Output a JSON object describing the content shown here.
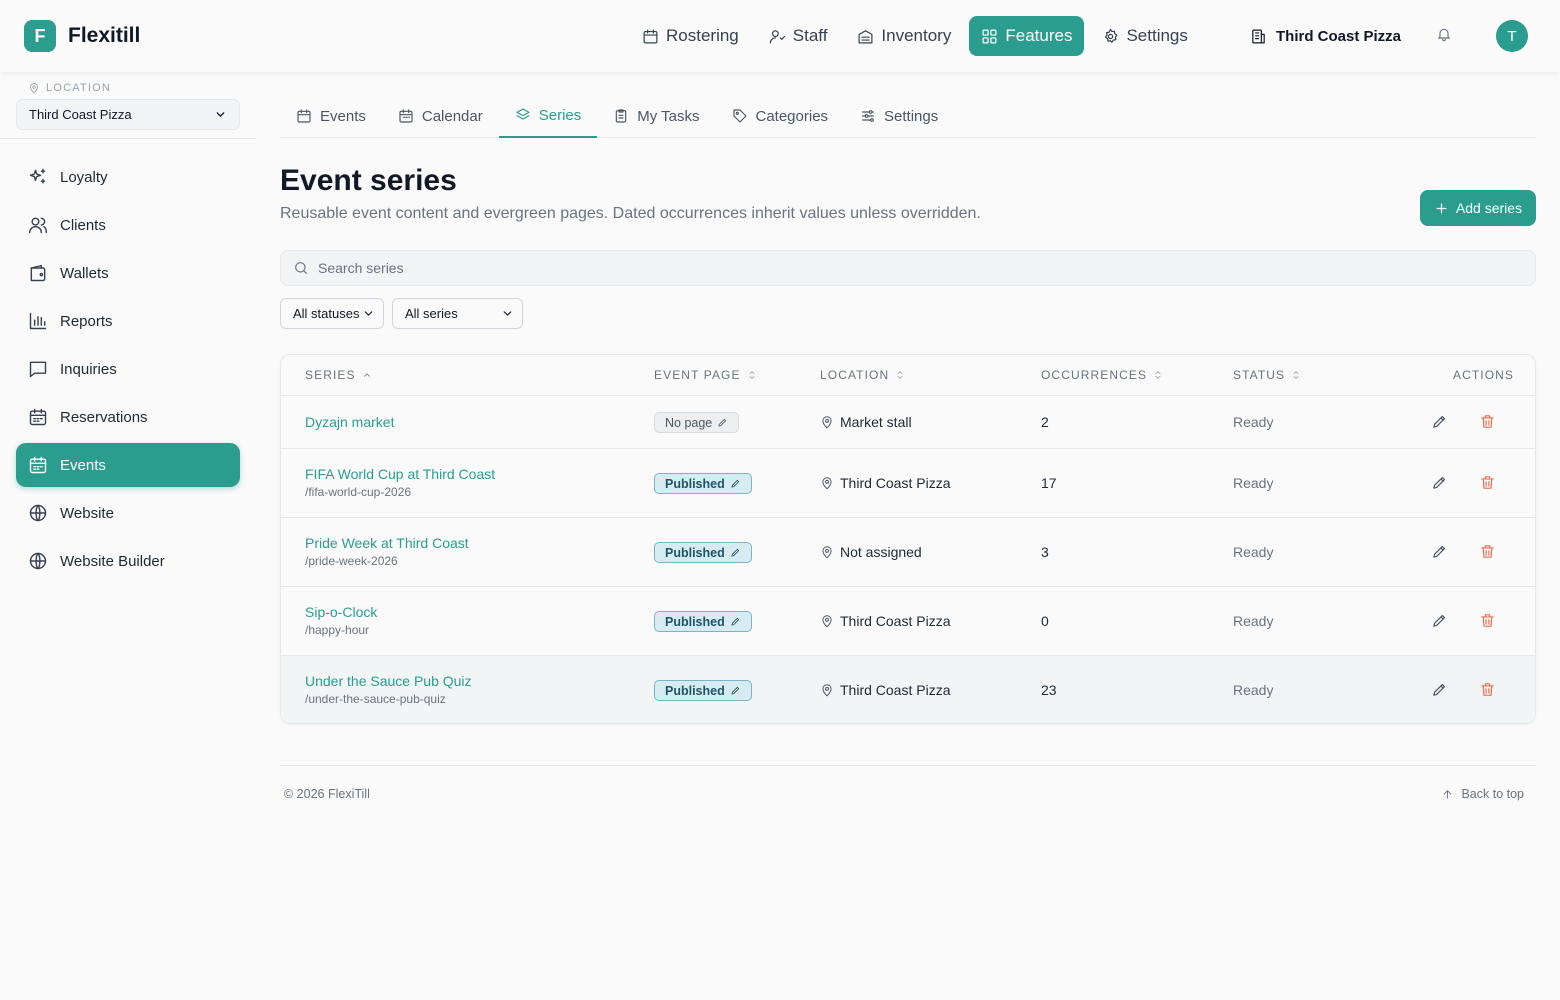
{
  "brand": {
    "logo_letter": "F",
    "name": "Flexitill"
  },
  "topnav": {
    "items": [
      {
        "label": "Rostering",
        "icon": "calendar-icon"
      },
      {
        "label": "Staff",
        "icon": "staff-icon"
      },
      {
        "label": "Inventory",
        "icon": "inventory-icon"
      },
      {
        "label": "Features",
        "icon": "grid-icon",
        "active": true
      },
      {
        "label": "Settings",
        "icon": "gear-icon"
      }
    ],
    "location": "Third Coast Pizza",
    "avatar_initial": "T"
  },
  "sidebar": {
    "location_label": "LOCATION",
    "location_value": "Third Coast Pizza",
    "items": [
      {
        "label": "Loyalty",
        "icon": "sparkles-icon"
      },
      {
        "label": "Clients",
        "icon": "users-icon"
      },
      {
        "label": "Wallets",
        "icon": "wallet-icon"
      },
      {
        "label": "Reports",
        "icon": "bar-chart-icon"
      },
      {
        "label": "Inquiries",
        "icon": "message-icon"
      },
      {
        "label": "Reservations",
        "icon": "calendar-icon"
      },
      {
        "label": "Events",
        "icon": "calendar-icon",
        "active": true
      },
      {
        "label": "Website",
        "icon": "globe-icon"
      },
      {
        "label": "Website Builder",
        "icon": "globe-icon"
      }
    ]
  },
  "tabs": [
    {
      "label": "Events",
      "icon": "calendar-icon"
    },
    {
      "label": "Calendar",
      "icon": "calendar-icon"
    },
    {
      "label": "Series",
      "icon": "layers-icon",
      "active": true
    },
    {
      "label": "My Tasks",
      "icon": "clipboard-icon"
    },
    {
      "label": "Categories",
      "icon": "tag-icon"
    },
    {
      "label": "Settings",
      "icon": "sliders-icon"
    }
  ],
  "page": {
    "title": "Event series",
    "subtitle": "Reusable event content and evergreen pages. Dated occurrences inherit values unless overridden.",
    "add_button": "Add series",
    "search_placeholder": "Search series",
    "filter_status": "All statuses",
    "filter_series": "All series"
  },
  "table": {
    "headers": {
      "series": "SERIES",
      "event_page": "EVENT PAGE",
      "location": "LOCATION",
      "occurrences": "OCCURRENCES",
      "status": "STATUS",
      "actions": "ACTIONS"
    },
    "rows": [
      {
        "name": "Dyzajn market",
        "slug": "",
        "page": "No page",
        "location": "Market stall",
        "occurrences": "2",
        "status": "Ready"
      },
      {
        "name": "FIFA World Cup at Third Coast",
        "slug": "/fifa-world-cup-2026",
        "page": "Published",
        "location": "Third Coast Pizza",
        "occurrences": "17",
        "status": "Ready"
      },
      {
        "name": "Pride Week at Third Coast",
        "slug": "/pride-week-2026",
        "page": "Published",
        "location": "Not assigned",
        "occurrences": "3",
        "status": "Ready"
      },
      {
        "name": "Sip-o-Clock",
        "slug": "/happy-hour",
        "page": "Published",
        "location": "Third Coast Pizza",
        "occurrences": "0",
        "status": "Ready"
      },
      {
        "name": "Under the Sauce Pub Quiz",
        "slug": "/under-the-sauce-pub-quiz",
        "page": "Published",
        "location": "Third Coast Pizza",
        "occurrences": "23",
        "status": "Ready"
      }
    ]
  },
  "footer": {
    "copyright": "© 2026 FlexiTill",
    "back_to_top": "Back to top"
  },
  "colors": {
    "accent": "#2a9d8f",
    "danger": "#e76f51"
  }
}
